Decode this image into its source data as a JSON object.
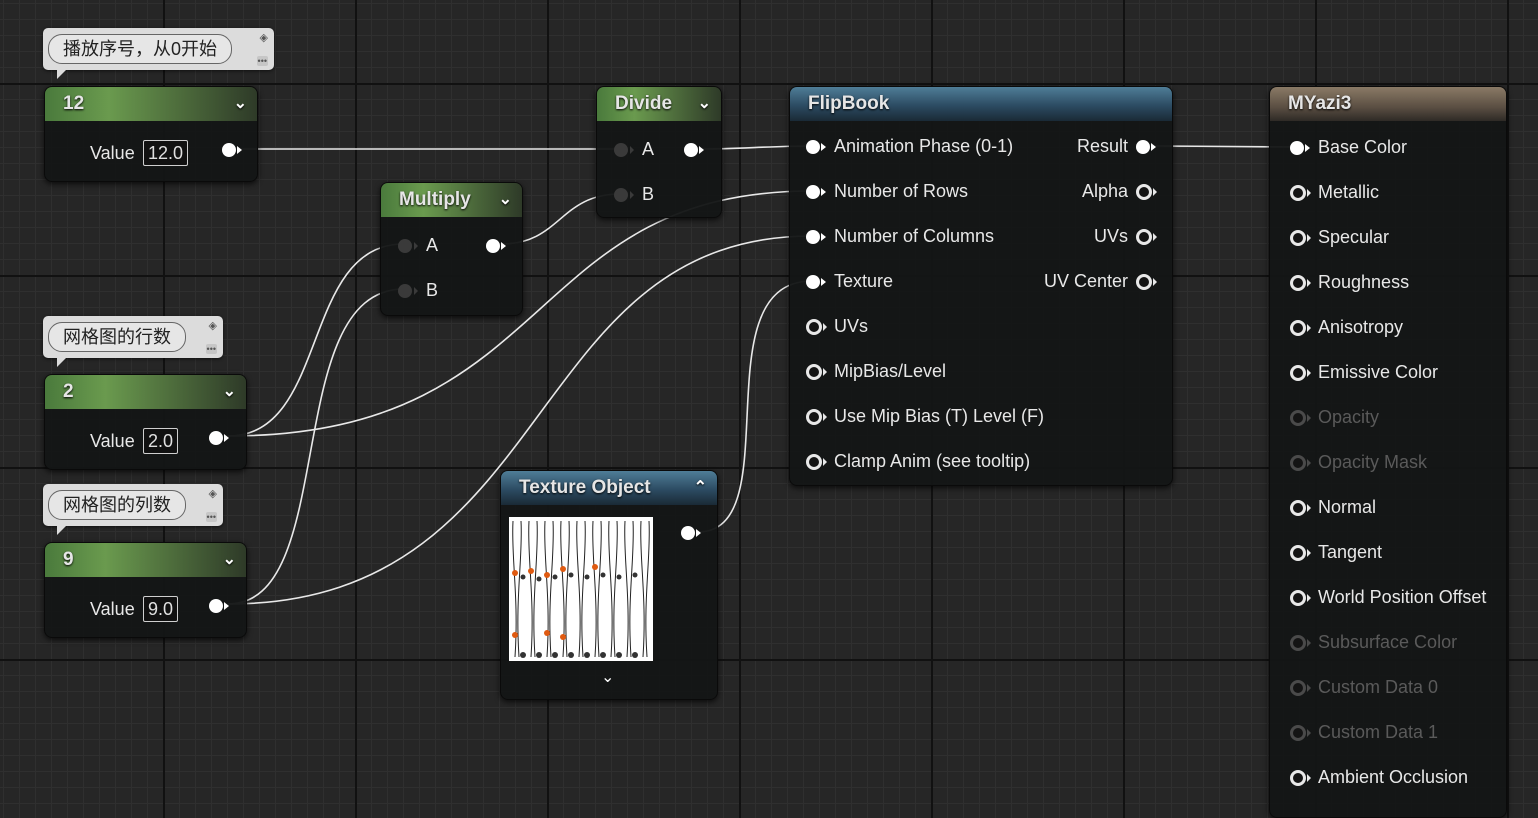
{
  "comments": {
    "play_index": "播放序号，从0开始",
    "grid_rows": "网格图的行数",
    "grid_cols": "网格图的列数"
  },
  "const_12": {
    "title": "12",
    "value_label": "Value",
    "value": "12.0"
  },
  "const_2": {
    "title": "2",
    "value_label": "Value",
    "value": "2.0"
  },
  "const_9": {
    "title": "9",
    "value_label": "Value",
    "value": "9.0"
  },
  "multiply": {
    "title": "Multiply",
    "in_a": "A",
    "in_b": "B"
  },
  "divide": {
    "title": "Divide",
    "in_a": "A",
    "in_b": "B"
  },
  "texture_object": {
    "title": "Texture Object"
  },
  "flipbook": {
    "title": "FlipBook",
    "inputs": [
      "Animation  Phase (0-1)",
      "Number of Rows",
      "Number of Columns",
      "Texture",
      "UVs",
      "MipBias/Level",
      "Use Mip Bias (T) Level (F)",
      "Clamp Anim (see tooltip)"
    ],
    "outputs": [
      "Result",
      "Alpha",
      "UVs",
      "UV Center"
    ]
  },
  "material": {
    "title": "MYazi3",
    "inputs": [
      "Base Color",
      "Metallic",
      "Specular",
      "Roughness",
      "Anisotropy",
      "Emissive Color",
      "Opacity",
      "Opacity Mask",
      "Normal",
      "Tangent",
      "World Position Offset",
      "Subsurface Color",
      "Custom Data 0",
      "Custom Data 1",
      "Ambient Occlusion"
    ],
    "disabled_inputs": [
      "Opacity",
      "Opacity Mask",
      "Subsurface Color",
      "Custom Data 0",
      "Custom Data 1"
    ]
  },
  "colors": {
    "graph_bg": "#262626",
    "constant_header": "#6a9a4e",
    "function_header": "#4f7d97",
    "material_header": "#8a7a66",
    "wire": "#e8e8e8"
  }
}
